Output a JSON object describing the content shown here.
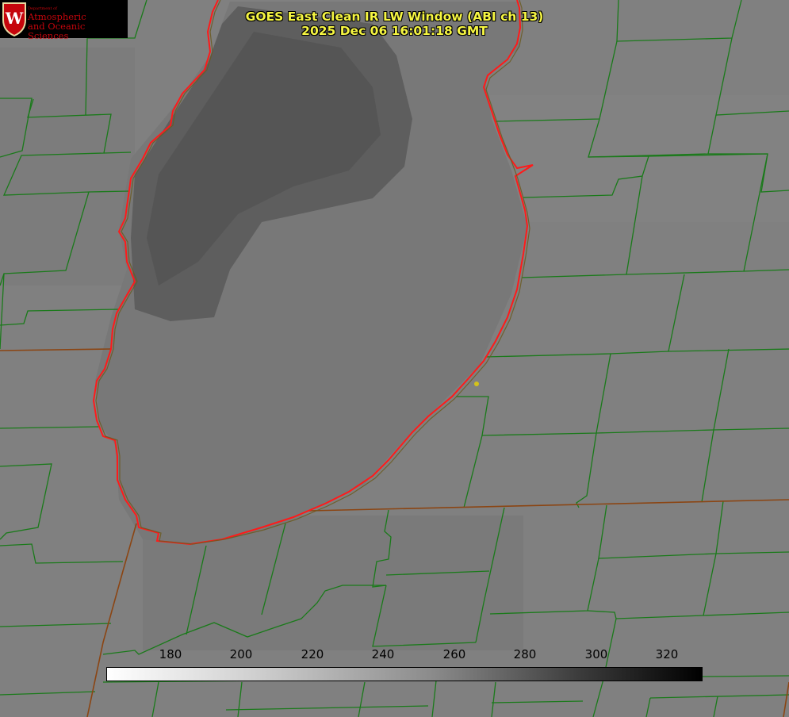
{
  "title": {
    "line1": "GOES East Clean IR LW Window (ABI ch 13)",
    "line2": "2025 Dec 06 16:01:18 GMT"
  },
  "logo": {
    "dept": "Department of",
    "line1": "Atmospheric",
    "line2": "and Oceanic Sciences",
    "letter": "W"
  },
  "colorbar": {
    "ticks": [
      "180",
      "200",
      "220",
      "240",
      "260",
      "280",
      "300",
      "320"
    ],
    "colors": {
      "low": "#ffffff",
      "high": "#000000"
    }
  },
  "colors": {
    "county_lines": "#1a7a1a",
    "state_lines": "#8b4513",
    "coastline": "#ff1a1a",
    "background": "#7e7e7e",
    "cloud": "#5a5a5a",
    "marker": "#d4c21a"
  }
}
